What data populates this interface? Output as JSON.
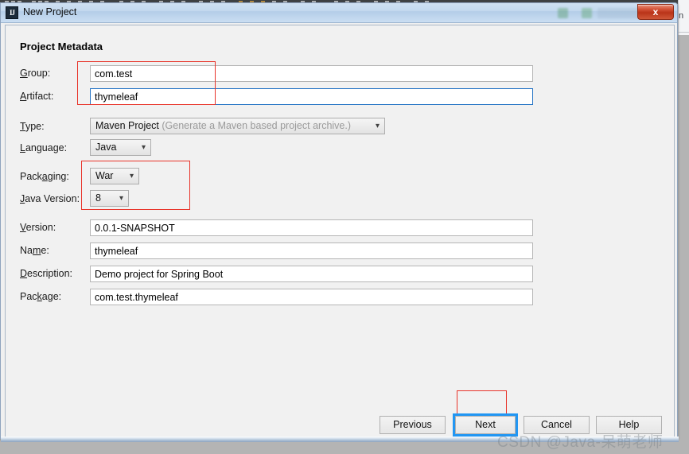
{
  "window": {
    "title": "New Project",
    "app_icon": "IJ",
    "close_label": "x"
  },
  "background": {
    "right_window_label": "n"
  },
  "section": {
    "title": "Project Metadata"
  },
  "form": {
    "fields": [
      {
        "label_pre": "",
        "label_key": "G",
        "label_post": "roup:",
        "value": "com.test",
        "type": "text"
      },
      {
        "label_pre": "",
        "label_key": "A",
        "label_post": "rtifact:",
        "value": "thymeleaf",
        "type": "text"
      },
      {
        "label_pre": "",
        "label_key": "T",
        "label_post": "ype:",
        "value": "Maven Project",
        "hint": "(Generate a Maven based project archive.)",
        "type": "combo"
      },
      {
        "label_pre": "",
        "label_key": "L",
        "label_post": "anguage:",
        "value": "Java",
        "type": "combo"
      },
      {
        "label_pre": "Pack",
        "label_key": "a",
        "label_post": "ging:",
        "value": "War",
        "type": "combo"
      },
      {
        "label_pre": "",
        "label_key": "J",
        "label_post": "ava Version:",
        "value": "8",
        "type": "combo"
      },
      {
        "label_pre": "",
        "label_key": "V",
        "label_post": "ersion:",
        "value": "0.0.1-SNAPSHOT",
        "type": "text"
      },
      {
        "label_pre": "Na",
        "label_key": "m",
        "label_post": "e:",
        "value": "thymeleaf",
        "type": "text"
      },
      {
        "label_pre": "",
        "label_key": "D",
        "label_post": "escription:",
        "value": "Demo project for Spring Boot",
        "type": "text"
      },
      {
        "label_pre": "Pac",
        "label_key": "k",
        "label_post": "age:",
        "value": "com.test.thymeleaf",
        "type": "text"
      }
    ]
  },
  "footer": {
    "buttons": [
      {
        "label": "Previous"
      },
      {
        "label": "Next"
      },
      {
        "label": "Cancel"
      },
      {
        "label": "Help"
      }
    ]
  },
  "watermark": {
    "text": "CSDN @Java-呆萌老师"
  },
  "colors": {
    "annotation_red": "#e8342a",
    "focus_blue": "#2196f3",
    "field_focus_blue": "#2272c4",
    "titlebar_blue": "#c2d8ee",
    "close_red": "#ba3419"
  }
}
